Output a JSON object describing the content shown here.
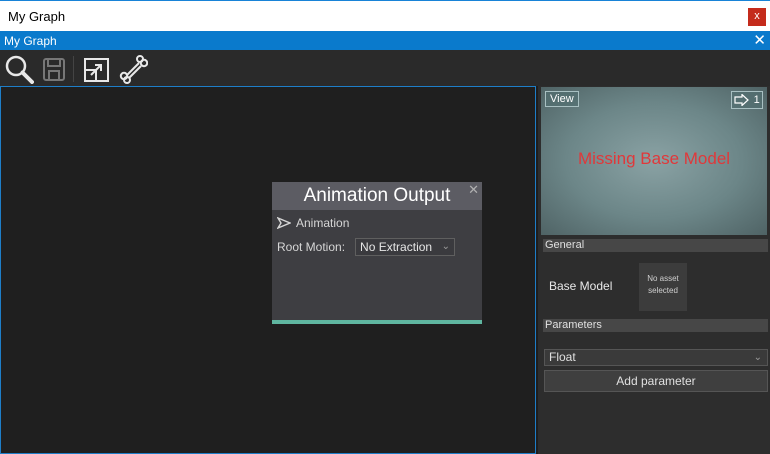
{
  "window": {
    "title": "My Graph",
    "close_label": "x"
  },
  "app_header": {
    "title": "My Graph",
    "close_label": "✕"
  },
  "toolbar": {
    "icons": [
      "search-icon",
      "save-icon",
      "export-icon",
      "bone-icon"
    ]
  },
  "node": {
    "title": "Animation Output",
    "close_label": "✕",
    "input_label": "Animation",
    "root_motion_label": "Root Motion:",
    "root_motion_value": "No Extraction",
    "accent_color": "#5fb6a0"
  },
  "preview": {
    "view_label": "View",
    "camera_count": "1",
    "message": "Missing Base Model",
    "message_color": "#e0383a"
  },
  "general": {
    "header": "General",
    "base_model_label": "Base Model",
    "asset_text_1": "No asset",
    "asset_text_2": "selected"
  },
  "parameters": {
    "header": "Parameters",
    "type_value": "Float",
    "add_label": "Add parameter"
  },
  "colors": {
    "accent": "#0a7acc"
  }
}
